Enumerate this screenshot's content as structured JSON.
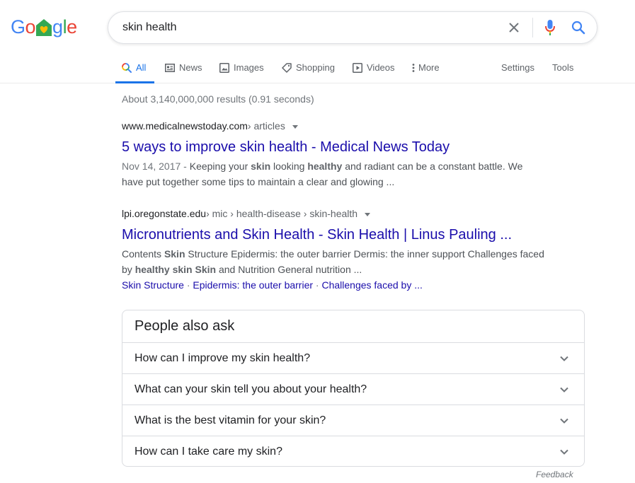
{
  "logo": {
    "letters": [
      "G",
      "o",
      "g",
      "l",
      "e"
    ]
  },
  "search": {
    "query": "skin health"
  },
  "tabs": [
    {
      "label": "All",
      "icon": "search-icon"
    },
    {
      "label": "News",
      "icon": "news-icon"
    },
    {
      "label": "Images",
      "icon": "images-icon"
    },
    {
      "label": "Shopping",
      "icon": "shopping-tag-icon"
    },
    {
      "label": "Videos",
      "icon": "video-play-icon"
    },
    {
      "label": "More",
      "icon": "more-vert-icon"
    }
  ],
  "tools": {
    "settings": "Settings",
    "tools": "Tools"
  },
  "stats": "About 3,140,000,000 results (0.91 seconds)",
  "results": [
    {
      "domain": "www.medicalnewstoday.com",
      "path": " › articles",
      "title": "5 ways to improve skin health - Medical News Today",
      "date": "Nov 14, 2017 - ",
      "snippet": [
        {
          "t": "Keeping your ",
          "b": false
        },
        {
          "t": "skin",
          "b": true
        },
        {
          "t": " looking ",
          "b": false
        },
        {
          "t": "healthy",
          "b": true
        },
        {
          "t": " and radiant can be a constant battle. We have put together some tips to maintain a clear and glowing ...",
          "b": false
        }
      ]
    },
    {
      "domain": "lpi.oregonstate.edu",
      "path": " › mic › health-disease › skin-health",
      "title": "Micronutrients and Skin Health - Skin Health | Linus Pauling ...",
      "snippet": [
        {
          "t": "Contents ",
          "b": false
        },
        {
          "t": "Skin",
          "b": true
        },
        {
          "t": " Structure Epidermis: the outer barrier Dermis: the inner support Challenges faced by ",
          "b": false
        },
        {
          "t": "healthy skin Skin",
          "b": true
        },
        {
          "t": " and Nutrition General nutrition ...",
          "b": false
        }
      ],
      "sitelinks": [
        "Skin Structure",
        "Epidermis: the outer barrier",
        "Challenges faced by ..."
      ],
      "sitelink_separator": " · "
    }
  ],
  "paa": {
    "title": "People also ask",
    "questions": [
      "How can I improve my skin health?",
      "What can your skin tell you about your health?",
      "What is the best vitamin for your skin?",
      "How can I take care my skin?"
    ]
  },
  "feedback": "Feedback",
  "colors": {
    "link": "#1a0dab",
    "accent": "#1a73e8",
    "blue": "#4285f4",
    "red": "#ea4335",
    "yellow": "#fbbc05",
    "green": "#34a853"
  }
}
